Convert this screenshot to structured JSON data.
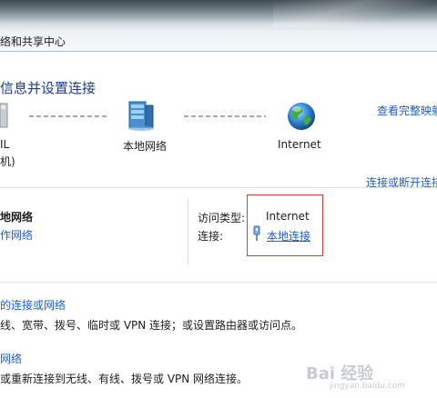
{
  "window": {
    "title": "络和共享中心"
  },
  "main": {
    "heading": "信息并设置连接",
    "full_map_link": "查看完整映射",
    "connect_link": "连接或断开连接"
  },
  "map": {
    "computer_label_line1": "IL",
    "computer_label_line2": "机)",
    "local_network_label": "本地网络",
    "internet_label": "Internet",
    "icons": [
      "computer-icon",
      "network-icon",
      "globe-icon"
    ]
  },
  "active_network": {
    "name": "地网络",
    "type_link": "作网络",
    "access_type_label": "访问类型:",
    "access_type_value": "Internet",
    "connections_label": "连接:",
    "connection_value": "本地连接",
    "highlight_color": "#d23c3c"
  },
  "tasks": [
    {
      "link": "的连接或网络",
      "description": "线、宽带、拨号、临时或 VPN 连接；或设置路由器或访问点。"
    },
    {
      "link": "网络",
      "description": "或重新连接到无线、有线、拨号或 VPN 网络连接。"
    }
  ],
  "watermark": {
    "text": "Bai 经验",
    "sub": "jingyan.baidu.com"
  },
  "colors": {
    "link": "#1f5fc7",
    "heading": "#1e3c8c",
    "highlight": "#d23c3c"
  }
}
